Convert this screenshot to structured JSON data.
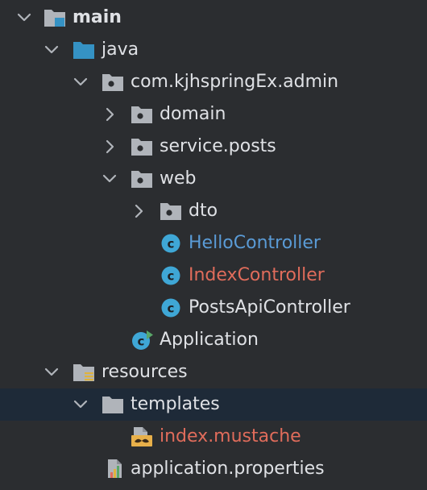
{
  "tree": {
    "main": "main",
    "java": "java",
    "package": "com.kjhspringEx.admin",
    "domain": "domain",
    "service_posts": "service.posts",
    "web": "web",
    "dto": "dto",
    "hello_controller": "HelloController",
    "index_controller": "IndexController",
    "posts_api_controller": "PostsApiController",
    "application": "Application",
    "resources": "resources",
    "templates": "templates",
    "index_mustache": "index.mustache",
    "application_properties": "application.properties"
  },
  "colors": {
    "background": "#2b2d30",
    "selected_row": "#1e2a38",
    "text": "#dfe1e5",
    "modified_blue": "#5a9bd6",
    "untracked_red": "#e06c5b",
    "folder_gray": "#b0b4ba",
    "source_folder_blue": "#3592c4",
    "class_teal": "#3fa7d6",
    "run_green": "#59a869"
  },
  "icons": [
    "chevron-down-icon",
    "chevron-right-icon",
    "module-folder-icon",
    "source-folder-icon",
    "package-folder-icon",
    "class-icon",
    "runnable-class-icon",
    "resources-folder-icon",
    "folder-icon",
    "mustache-file-icon",
    "properties-file-icon"
  ]
}
